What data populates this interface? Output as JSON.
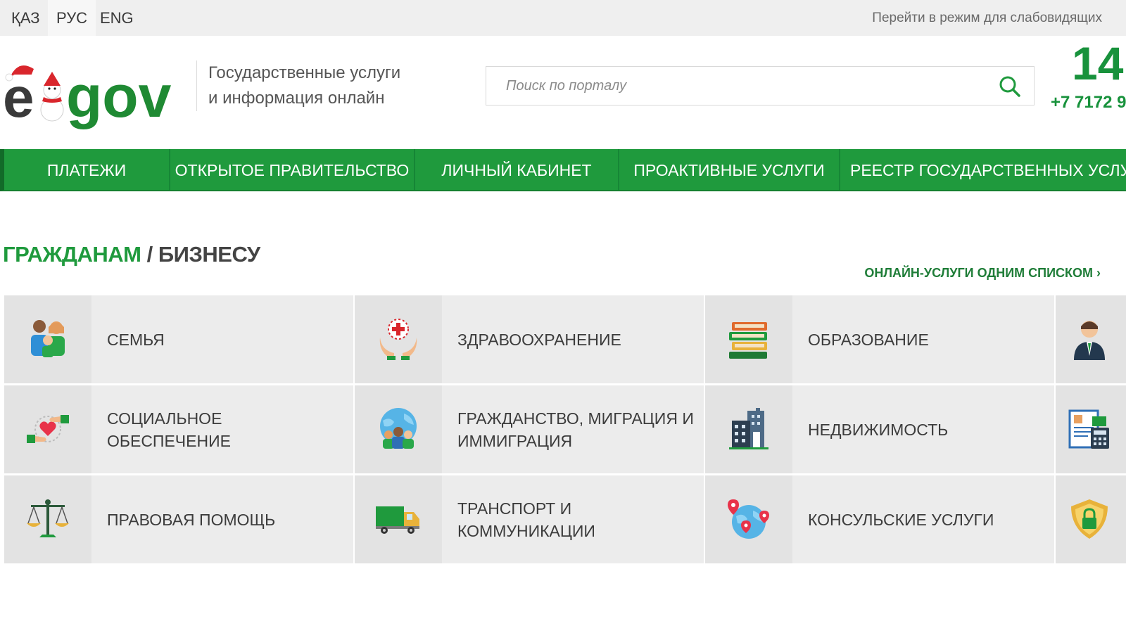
{
  "topbar": {
    "languages": [
      "ҚАЗ",
      "РУС",
      "ENG"
    ],
    "active_language": "РУС",
    "low_vision_link": "Перейти в режим для слабовидящих"
  },
  "header": {
    "logo_text": "egov",
    "tagline_line1": "Государственные услуги",
    "tagline_line2": "и информация онлайн",
    "search_placeholder": "Поиск по порталу",
    "hotline_number": "14",
    "hotline_phone": "+7 7172 9"
  },
  "nav": {
    "items": [
      "ПЛАТЕЖИ",
      "ОТКРЫТОЕ ПРАВИТЕЛЬСТВО",
      "ЛИЧНЫЙ КАБИНЕТ",
      "ПРОАКТИВНЫЕ УСЛУГИ",
      "РЕЕСТР ГОСУДАРСТВЕННЫХ УСЛУГ"
    ]
  },
  "section": {
    "tab_citizens": "ГРАЖДАНАМ",
    "separator": "/",
    "tab_business": "БИЗНЕСУ",
    "all_services_link": "ОНЛАЙН-УСЛУГИ ОДНИМ СПИСКОМ ›"
  },
  "categories": [
    {
      "label": "СЕМЬЯ",
      "icon": "family-icon"
    },
    {
      "label": "ЗДРАВООХРАНЕНИЕ",
      "icon": "healthcare-icon"
    },
    {
      "label": "ОБРАЗОВАНИЕ",
      "icon": "books-icon"
    },
    {
      "label": "",
      "icon": "employee-icon"
    },
    {
      "label": "СОЦИАЛЬНОЕ ОБЕСПЕЧЕНИЕ",
      "icon": "social-care-icon"
    },
    {
      "label": "ГРАЖДАНСТВО, МИГРАЦИЯ И ИММИГРАЦИЯ",
      "icon": "globe-people-icon"
    },
    {
      "label": "НЕДВИЖИМОСТЬ",
      "icon": "buildings-icon"
    },
    {
      "label": "",
      "icon": "calculator-document-icon"
    },
    {
      "label": "ПРАВОВАЯ ПОМОЩЬ",
      "icon": "scales-icon"
    },
    {
      "label": "ТРАНСПОРТ И КОММУНИКАЦИИ",
      "icon": "truck-icon"
    },
    {
      "label": "КОНСУЛЬСКИЕ УСЛУГИ",
      "icon": "globe-pins-icon"
    },
    {
      "label": "",
      "icon": "shield-lock-icon"
    }
  ],
  "colors": {
    "brand_green": "#1f9a3d",
    "topbar_bg": "#efefef",
    "tile_bg": "#ececec"
  }
}
